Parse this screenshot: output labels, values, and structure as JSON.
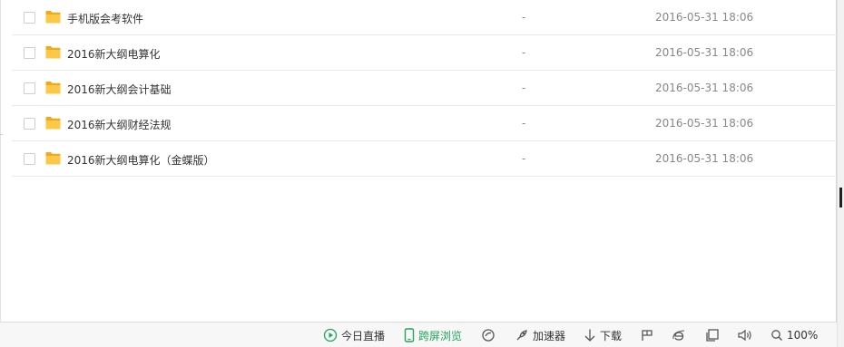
{
  "files": [
    {
      "name": "手机版会考软件",
      "size": "-",
      "date": "2016-05-31 18:06"
    },
    {
      "name": "2016新大纲电算化",
      "size": "-",
      "date": "2016-05-31 18:06"
    },
    {
      "name": "2016新大纲会计基础",
      "size": "-",
      "date": "2016-05-31 18:06"
    },
    {
      "name": "2016新大纲财经法规",
      "size": "-",
      "date": "2016-05-31 18:06"
    },
    {
      "name": "2016新大纲电算化（金蝶版）",
      "size": "-",
      "date": "2016-05-31 18:06"
    }
  ],
  "statusbar": {
    "live": "今日直播",
    "cross_screen": "跨屏浏览",
    "accelerator": "加速器",
    "download": "下载",
    "zoom": "100%"
  },
  "colors": {
    "folder": "#f5b82e",
    "accent_green": "#22a35a"
  },
  "icons": [
    "folder-icon",
    "play-circle-icon",
    "phone-icon",
    "refresh-icon",
    "rocket-icon",
    "download-arrow-icon",
    "flag-icon",
    "ie-icon",
    "window-icon",
    "speaker-icon",
    "zoom-icon"
  ]
}
